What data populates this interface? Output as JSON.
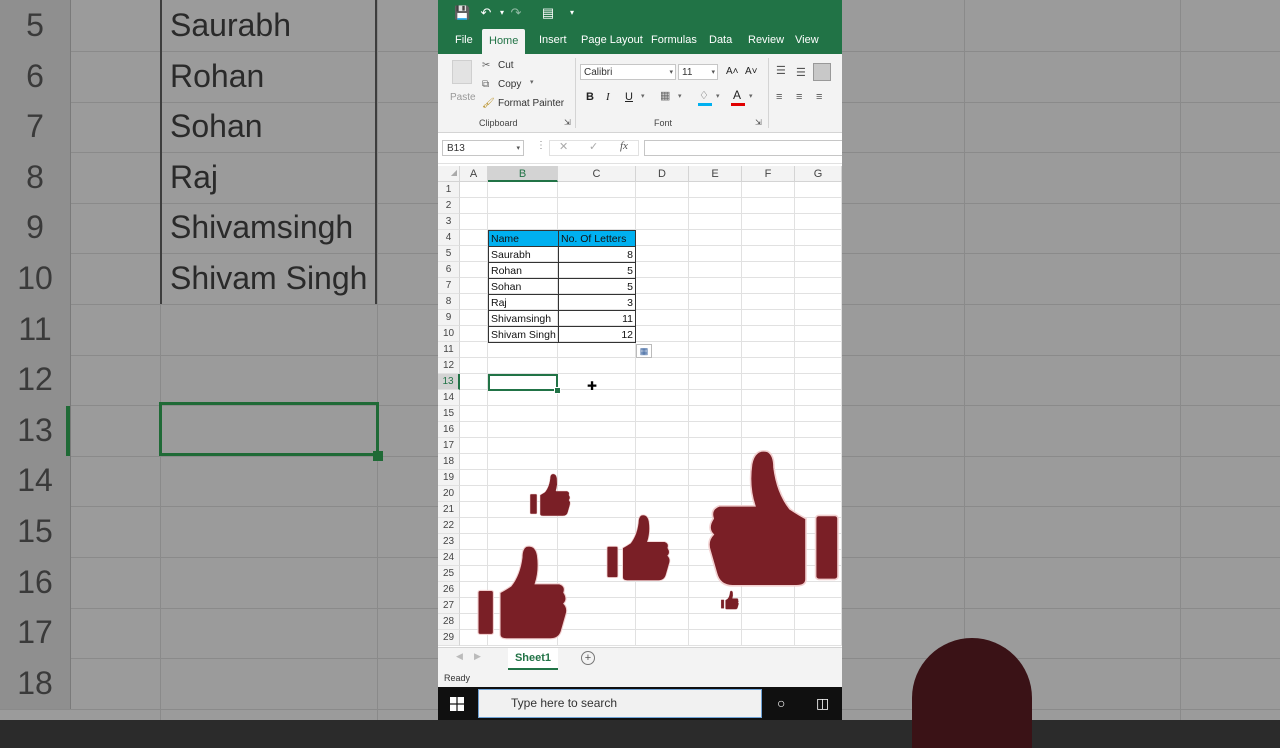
{
  "background": {
    "rows": [
      {
        "num": "5",
        "name": "Saurabh"
      },
      {
        "num": "6",
        "name": "Rohan"
      },
      {
        "num": "7",
        "name": "Sohan"
      },
      {
        "num": "8",
        "name": "Raj"
      },
      {
        "num": "9",
        "name": "Shivamsingh"
      },
      {
        "num": "10",
        "name": "Shivam Singh"
      },
      {
        "num": "11",
        "name": ""
      },
      {
        "num": "12",
        "name": ""
      },
      {
        "num": "13",
        "name": ""
      },
      {
        "num": "14",
        "name": ""
      },
      {
        "num": "15",
        "name": ""
      },
      {
        "num": "16",
        "name": ""
      },
      {
        "num": "17",
        "name": ""
      },
      {
        "num": "18",
        "name": ""
      }
    ]
  },
  "ribbon_tabs": [
    "File",
    "Home",
    "Insert",
    "Page Layout",
    "Formulas",
    "Data",
    "Review",
    "View"
  ],
  "active_tab": "Home",
  "clipboard": {
    "paste": "Paste",
    "cut": "Cut",
    "copy": "Copy",
    "format_painter": "Format Painter",
    "group_label": "Clipboard"
  },
  "font": {
    "name": "Calibri",
    "size": "11",
    "group_label": "Font",
    "bold": "B",
    "italic": "I",
    "underline": "U",
    "grow": "A˄",
    "shrink": "A˅"
  },
  "formula_bar": {
    "name_box": "B13",
    "fx": "fx",
    "value": ""
  },
  "columns": [
    "A",
    "B",
    "C",
    "D",
    "E",
    "F",
    "G"
  ],
  "selected_column": "B",
  "row_numbers": [
    "1",
    "2",
    "3",
    "4",
    "5",
    "6",
    "7",
    "8",
    "9",
    "10",
    "11",
    "12",
    "13",
    "14",
    "15",
    "16",
    "17",
    "18",
    "19",
    "20",
    "21",
    "22",
    "23",
    "24",
    "25",
    "26",
    "27",
    "28",
    "29"
  ],
  "selected_row": "13",
  "table": {
    "headers": [
      "Name",
      "No. Of Letters"
    ],
    "rows": [
      [
        "Saurabh",
        "8"
      ],
      [
        "Rohan",
        "5"
      ],
      [
        "Sohan",
        "5"
      ],
      [
        "Raj",
        "3"
      ],
      [
        "Shivamsingh",
        "11"
      ],
      [
        "Shivam Singh",
        "12"
      ]
    ]
  },
  "sheet_tab": "Sheet1",
  "status": "Ready",
  "taskbar": {
    "search_placeholder": "Type here to search"
  },
  "colors": {
    "excel_green": "#217346",
    "header_fill": "#00b0f0",
    "thumbs": "#7a1f26"
  },
  "icons": [
    "save-icon",
    "undo-icon",
    "redo-icon",
    "thumbs-up-icon",
    "windows-icon",
    "cortana-icon",
    "task-view-icon"
  ]
}
